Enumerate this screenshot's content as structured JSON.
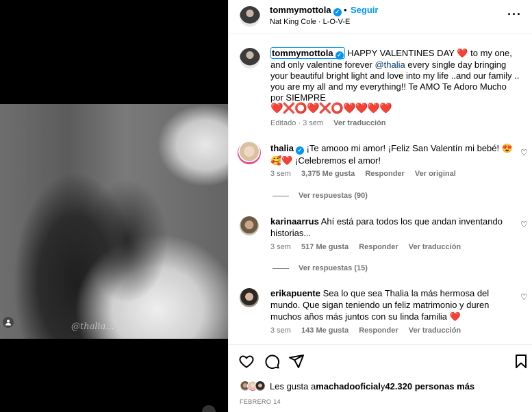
{
  "media": {
    "watermark": "@thalia...",
    "colors": {
      "background": "#000000"
    }
  },
  "header": {
    "username": "tommymottola",
    "separator": "•",
    "follow_label": "Seguir",
    "song": "Nat King Cole · L-O-V-E",
    "more_icon": "more-horizontal-icon"
  },
  "caption": {
    "username": "tommymottola",
    "text_before_mention": " HAPPY VALENTINES DAY ",
    "heart_1": "❤️",
    "text_after_heart": " to my one, and only valentine forever ",
    "mention": "@thalia",
    "text_after_mention": " every single day bringing your beautiful bright light and love into my life ..and our family .. you are my all and my everything!! Te AMO Te Adoro Mucho por SIEMPRE",
    "hearts_line": "❤️❌⭕❤️❌⭕❤️❤️❤️❤️",
    "meta_edited": "Editado · 3 sem",
    "meta_translate": "Ver traducción"
  },
  "comments": [
    {
      "username": "thalia",
      "verified": true,
      "text": " ¡Te amooo mi amor! ¡Feliz San Valentín mi bebé! 😍🥰❤️ ¡Celebremos el amor!",
      "time": "3 sem",
      "likes": "3,375 Me gusta",
      "reply": "Responder",
      "extra": "Ver original",
      "view_replies": "Ver respuestas (90)"
    },
    {
      "username": "karinaarrus",
      "verified": false,
      "text": " Ahí está para todos los que andan inventando historias...",
      "time": "3 sem",
      "likes": "517 Me gusta",
      "reply": "Responder",
      "extra": "Ver traducción",
      "view_replies": "Ver respuestas (15)"
    },
    {
      "username": "erikapuente",
      "verified": false,
      "text": " Sea lo que sea Thalia la más hermosa del mundo. Que sigan teniendo un feliz matrimonio y duren muchos años más juntos con su linda familia ❤️",
      "time": "3 sem",
      "likes": "143 Me gusta",
      "reply": "Responder",
      "extra": "Ver traducción",
      "view_replies": ""
    }
  ],
  "likes": {
    "prefix": "Les gusta a ",
    "user": "machadooficial",
    "middle": " y ",
    "count": "42.320 personas más"
  },
  "date": "FEBRERO 14",
  "colors": {
    "accent": "#0095f6",
    "muted": "#737373",
    "heart": "#e0245e"
  }
}
